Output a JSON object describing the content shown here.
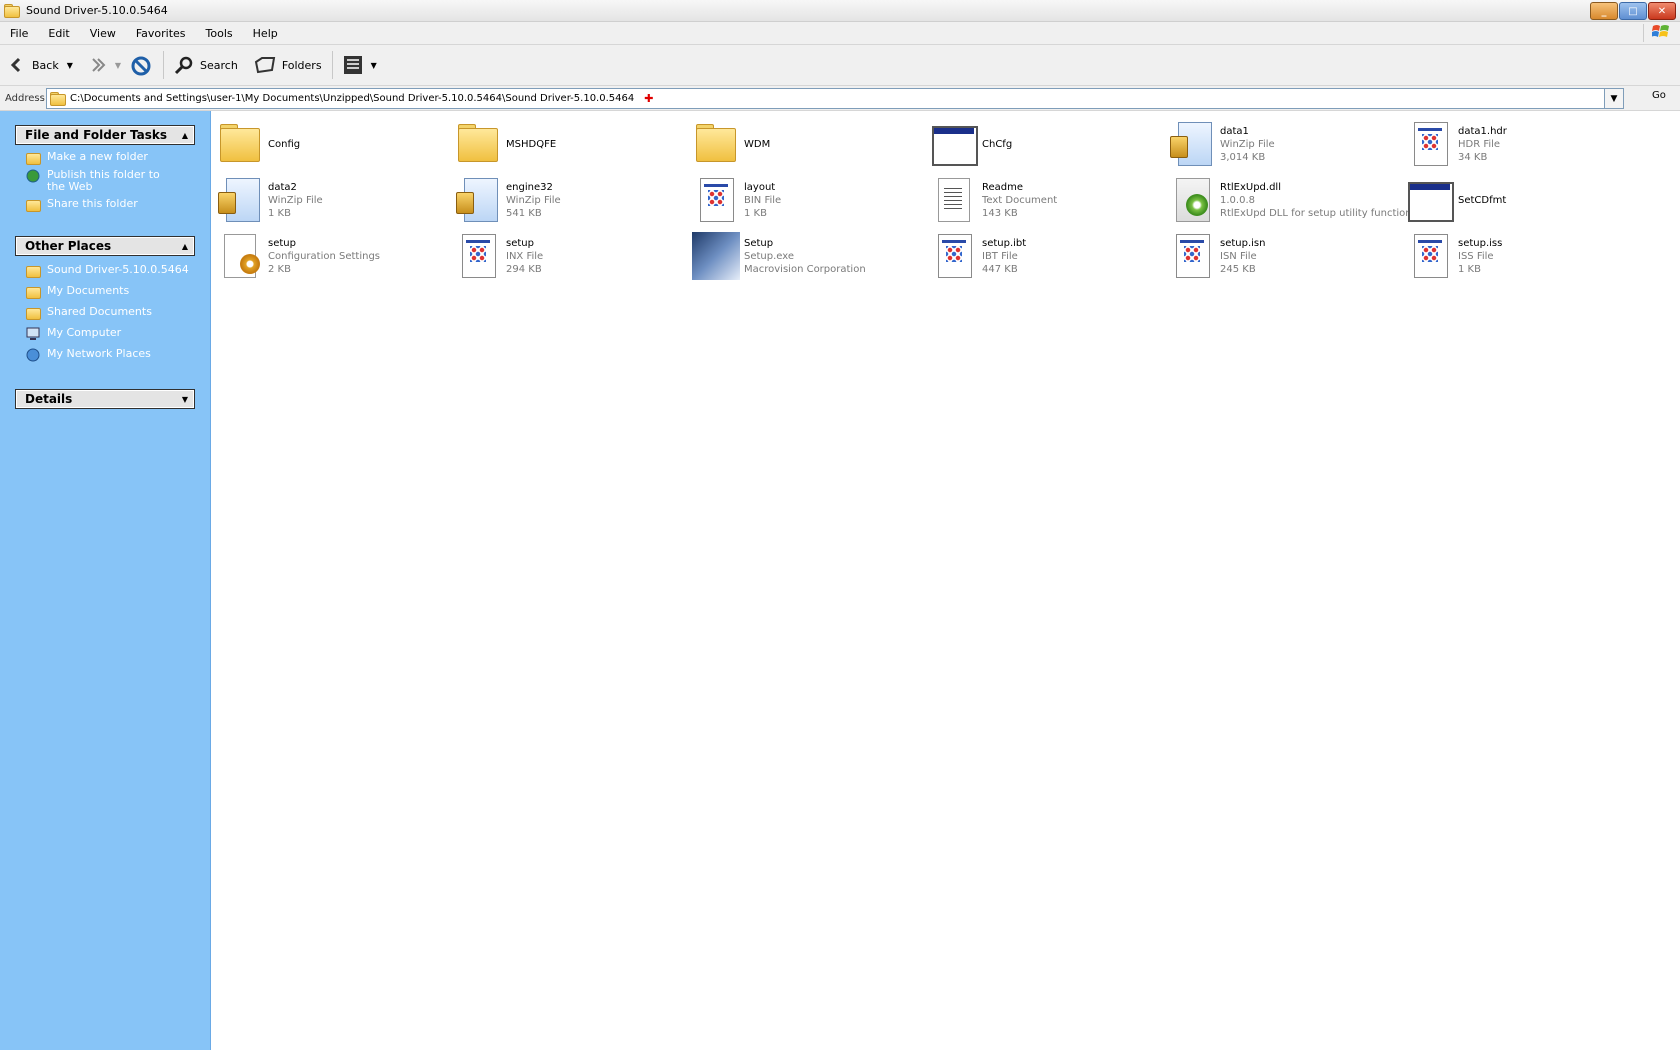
{
  "window": {
    "title": "Sound Driver-5.10.0.5464"
  },
  "menu": [
    "File",
    "Edit",
    "View",
    "Favorites",
    "Tools",
    "Help"
  ],
  "toolbar": {
    "back": "Back",
    "search": "Search",
    "folders": "Folders"
  },
  "address": {
    "label": "Address",
    "path": "C:\\Documents and Settings\\user-1\\My Documents\\Unzipped\\Sound Driver-5.10.0.5464\\Sound Driver-5.10.0.5464",
    "go": "Go"
  },
  "leftpane": {
    "tasks_title": "File and Folder Tasks",
    "tasks": [
      {
        "label": "Make a new folder",
        "icon": "new-folder-icon"
      },
      {
        "label": "Publish this folder to the Web",
        "icon": "globe-icon"
      },
      {
        "label": "Share this folder",
        "icon": "share-folder-icon"
      }
    ],
    "places_title": "Other Places",
    "places": [
      {
        "label": "Sound Driver-5.10.0.5464",
        "icon": "folder-icon"
      },
      {
        "label": "My Documents",
        "icon": "folder-icon"
      },
      {
        "label": "Shared Documents",
        "icon": "folder-icon"
      },
      {
        "label": "My Computer",
        "icon": "computer-icon"
      },
      {
        "label": "My Network Places",
        "icon": "network-icon"
      }
    ],
    "details_title": "Details"
  },
  "files": [
    {
      "name": "Config",
      "line2": "",
      "line3": "",
      "icon": "folder"
    },
    {
      "name": "MSHDQFE",
      "line2": "",
      "line3": "",
      "icon": "folder"
    },
    {
      "name": "WDM",
      "line2": "",
      "line3": "",
      "icon": "folder"
    },
    {
      "name": "ChCfg",
      "line2": "",
      "line3": "",
      "icon": "window"
    },
    {
      "name": "data1",
      "line2": "WinZip File",
      "line3": "3,014 KB",
      "icon": "zip"
    },
    {
      "name": "data1.hdr",
      "line2": "HDR File",
      "line3": "34 KB",
      "icon": "generic"
    },
    {
      "name": "data2",
      "line2": "WinZip File",
      "line3": "1 KB",
      "icon": "zip"
    },
    {
      "name": "engine32",
      "line2": "WinZip File",
      "line3": "541 KB",
      "icon": "zip"
    },
    {
      "name": "layout",
      "line2": "BIN File",
      "line3": "1 KB",
      "icon": "generic"
    },
    {
      "name": "Readme",
      "line2": "Text Document",
      "line3": "143 KB",
      "icon": "text"
    },
    {
      "name": "RtlExUpd.dll",
      "line2": "1.0.0.8",
      "line3": "RtlExUpd DLL for setup utility function",
      "icon": "dll"
    },
    {
      "name": "SetCDfmt",
      "line2": "",
      "line3": "",
      "icon": "window"
    },
    {
      "name": "setup",
      "line2": "Configuration Settings",
      "line3": "2 KB",
      "icon": "config"
    },
    {
      "name": "setup",
      "line2": "INX File",
      "line3": "294 KB",
      "icon": "generic"
    },
    {
      "name": "Setup",
      "line2": "Setup.exe",
      "line3": "Macrovision Corporation",
      "icon": "setup-exe"
    },
    {
      "name": "setup.ibt",
      "line2": "IBT File",
      "line3": "447 KB",
      "icon": "generic"
    },
    {
      "name": "setup.isn",
      "line2": "ISN File",
      "line3": "245 KB",
      "icon": "generic"
    },
    {
      "name": "setup.iss",
      "line2": "ISS File",
      "line3": "1 KB",
      "icon": "generic"
    }
  ]
}
